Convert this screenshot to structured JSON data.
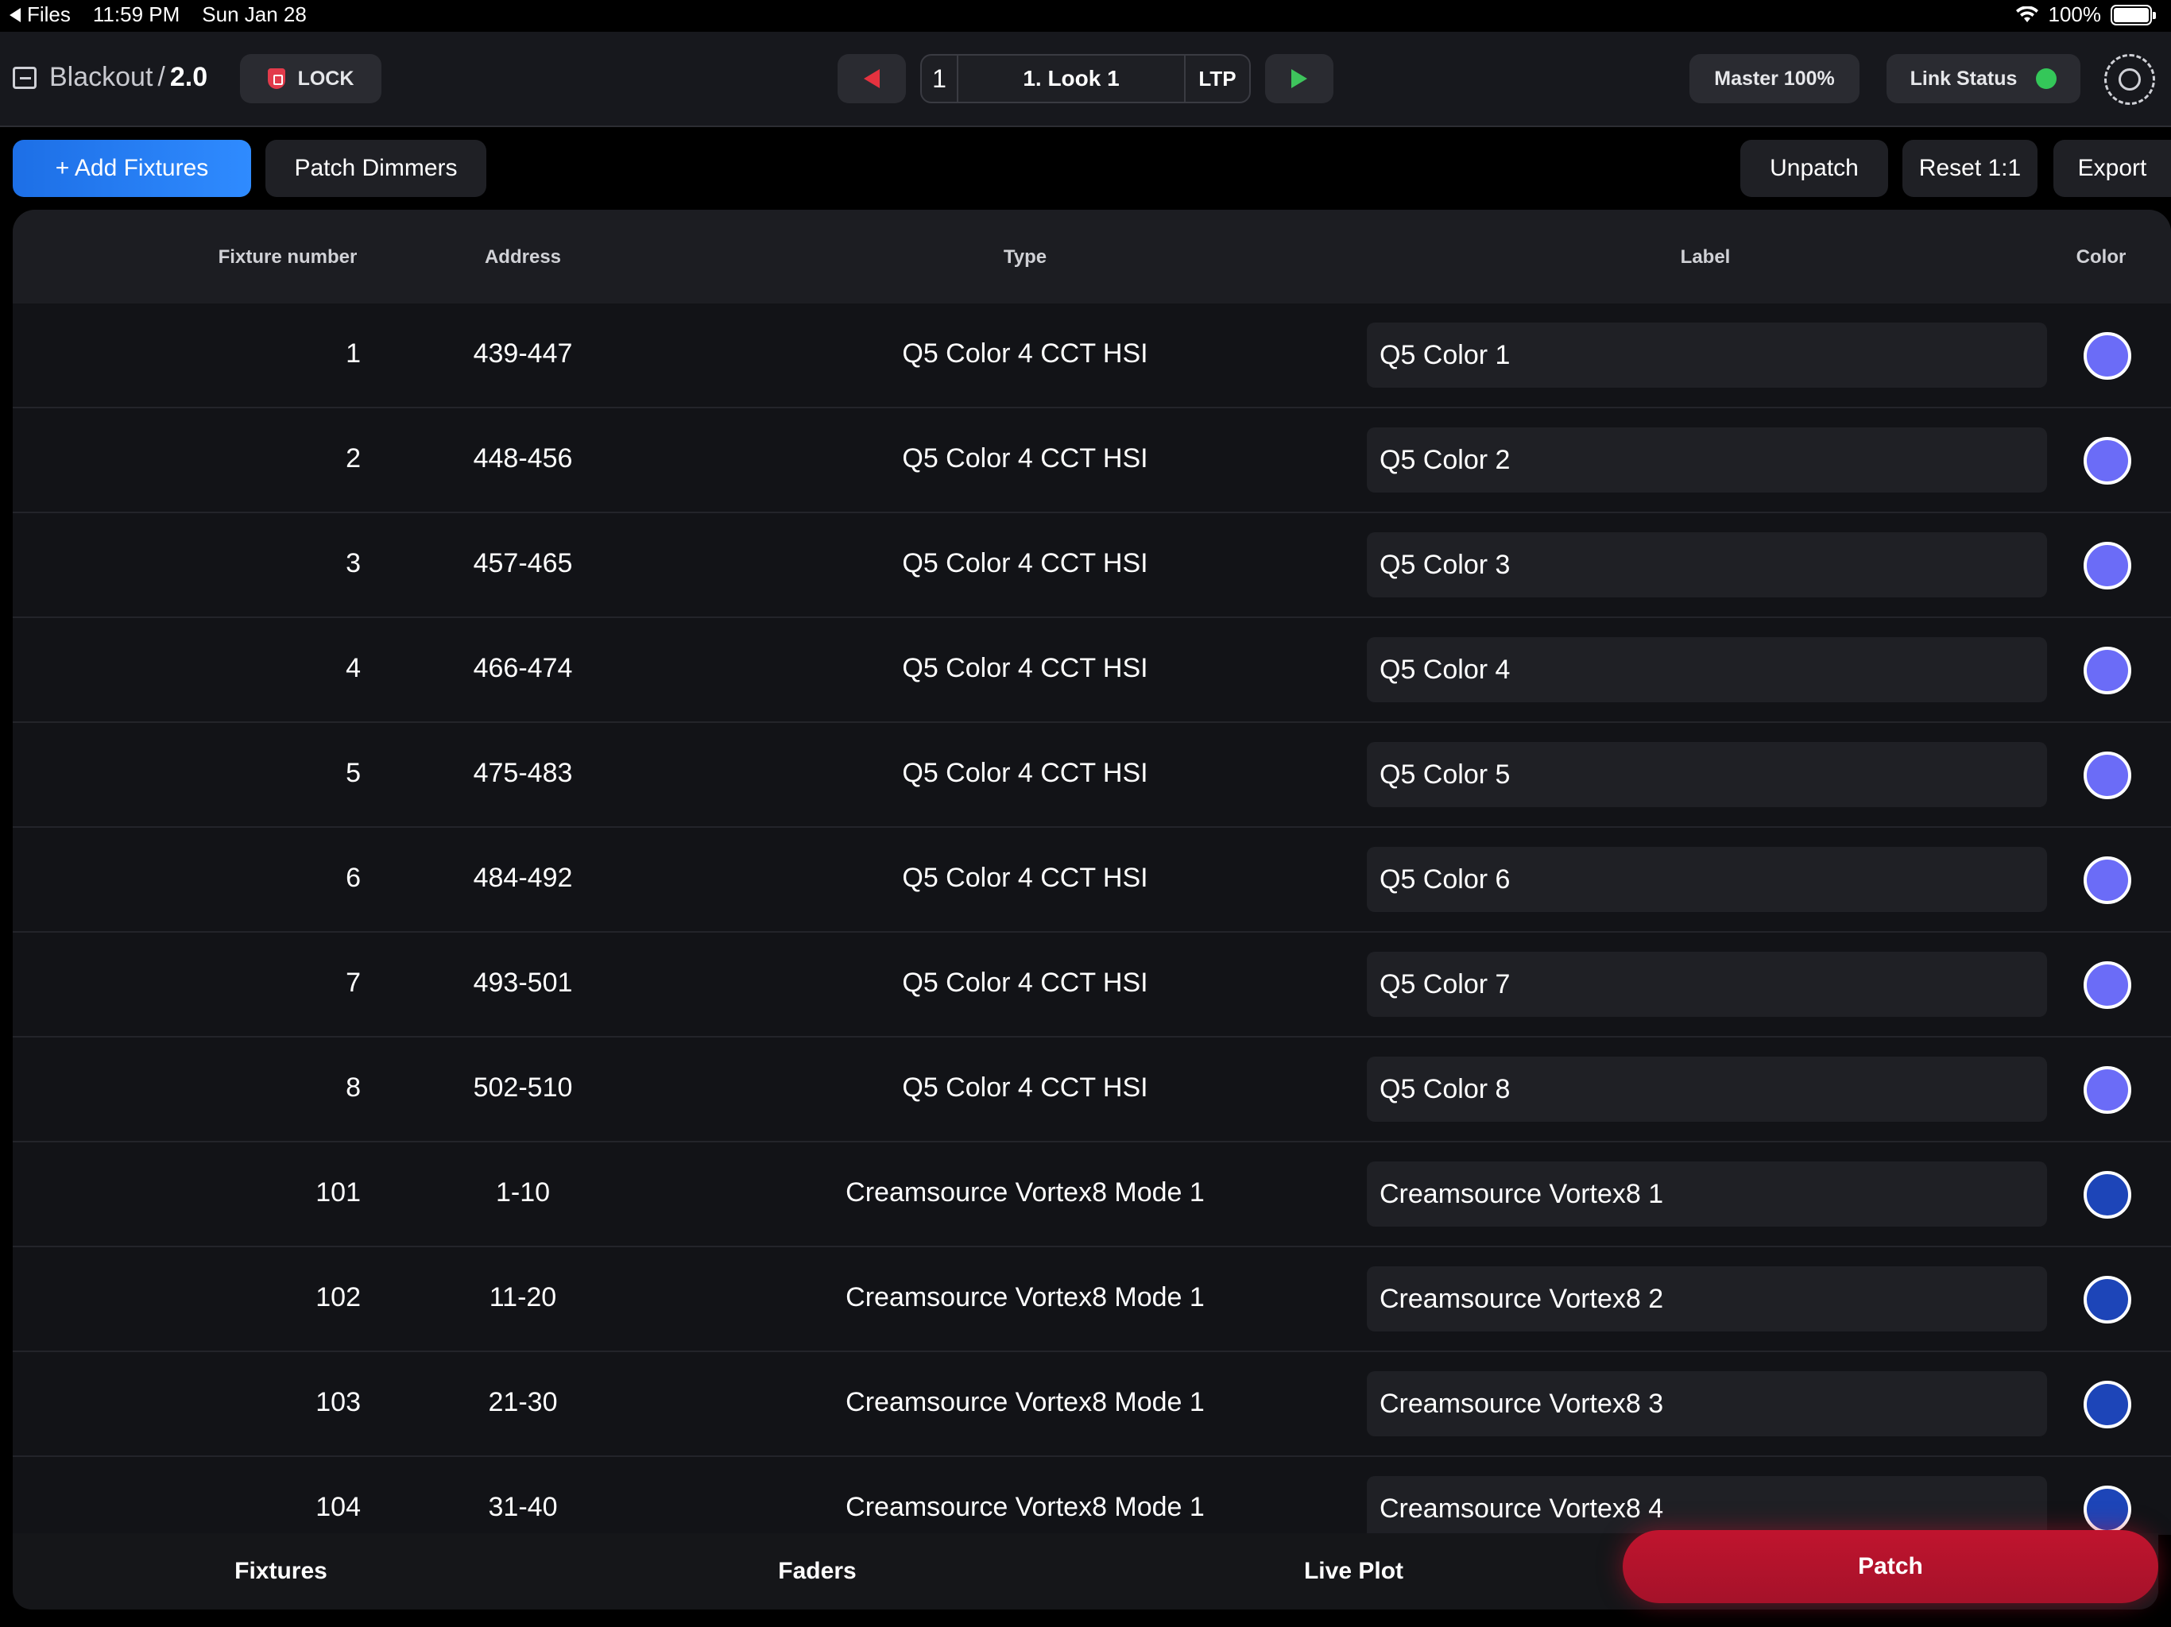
{
  "status_bar": {
    "back_app": "Files",
    "time": "11:59 PM",
    "date": "Sun Jan 28",
    "battery": "100%"
  },
  "header": {
    "app_name": "Blackout",
    "separator": "/",
    "version": "2.0",
    "lock_label": "LOCK",
    "cue_number": "1",
    "cue_name": "1. Look 1",
    "cue_mode": "LTP",
    "master_label": "Master 100%",
    "link_status_label": "Link Status",
    "link_status_color": "#34c759"
  },
  "toolbar": {
    "add_fixtures": "+ Add Fixtures",
    "patch_dimmers": "Patch Dimmers",
    "unpatch": "Unpatch",
    "reset": "Reset 1:1",
    "export": "Export"
  },
  "table": {
    "columns": {
      "fixture_number": "Fixture number",
      "address": "Address",
      "type": "Type",
      "label": "Label",
      "color": "Color"
    },
    "rows": [
      {
        "num": "1",
        "address": "439-447",
        "type": "Q5 Color 4 CCT HSI",
        "label": "Q5 Color 1",
        "color": "#6b6cf7"
      },
      {
        "num": "2",
        "address": "448-456",
        "type": "Q5 Color 4 CCT HSI",
        "label": "Q5 Color 2",
        "color": "#6b6cf7"
      },
      {
        "num": "3",
        "address": "457-465",
        "type": "Q5 Color 4 CCT HSI",
        "label": "Q5 Color 3",
        "color": "#6b6cf7"
      },
      {
        "num": "4",
        "address": "466-474",
        "type": "Q5 Color 4 CCT HSI",
        "label": "Q5 Color 4",
        "color": "#6b6cf7"
      },
      {
        "num": "5",
        "address": "475-483",
        "type": "Q5 Color 4 CCT HSI",
        "label": "Q5 Color 5",
        "color": "#6b6cf7"
      },
      {
        "num": "6",
        "address": "484-492",
        "type": "Q5 Color 4 CCT HSI",
        "label": "Q5 Color 6",
        "color": "#6b6cf7"
      },
      {
        "num": "7",
        "address": "493-501",
        "type": "Q5 Color 4 CCT HSI",
        "label": "Q5 Color 7",
        "color": "#6b6cf7"
      },
      {
        "num": "8",
        "address": "502-510",
        "type": "Q5 Color 4 CCT HSI",
        "label": "Q5 Color 8",
        "color": "#6b6cf7"
      },
      {
        "num": "101",
        "address": "1-10",
        "type": "Creamsource Vortex8 Mode 1",
        "label": "Creamsource Vortex8 1",
        "color": "#1d45b8"
      },
      {
        "num": "102",
        "address": "11-20",
        "type": "Creamsource Vortex8 Mode 1",
        "label": "Creamsource Vortex8 2",
        "color": "#1d45b8"
      },
      {
        "num": "103",
        "address": "21-30",
        "type": "Creamsource Vortex8 Mode 1",
        "label": "Creamsource Vortex8 3",
        "color": "#1d45b8"
      },
      {
        "num": "104",
        "address": "31-40",
        "type": "Creamsource Vortex8 Mode 1",
        "label": "Creamsource Vortex8 4",
        "color": "#1d45b8"
      }
    ]
  },
  "bottom_nav": {
    "fixtures": "Fixtures",
    "faders": "Faders",
    "live_plot": "Live Plot",
    "patch": "Patch",
    "active": "Patch",
    "active_color": "#c0142e"
  }
}
